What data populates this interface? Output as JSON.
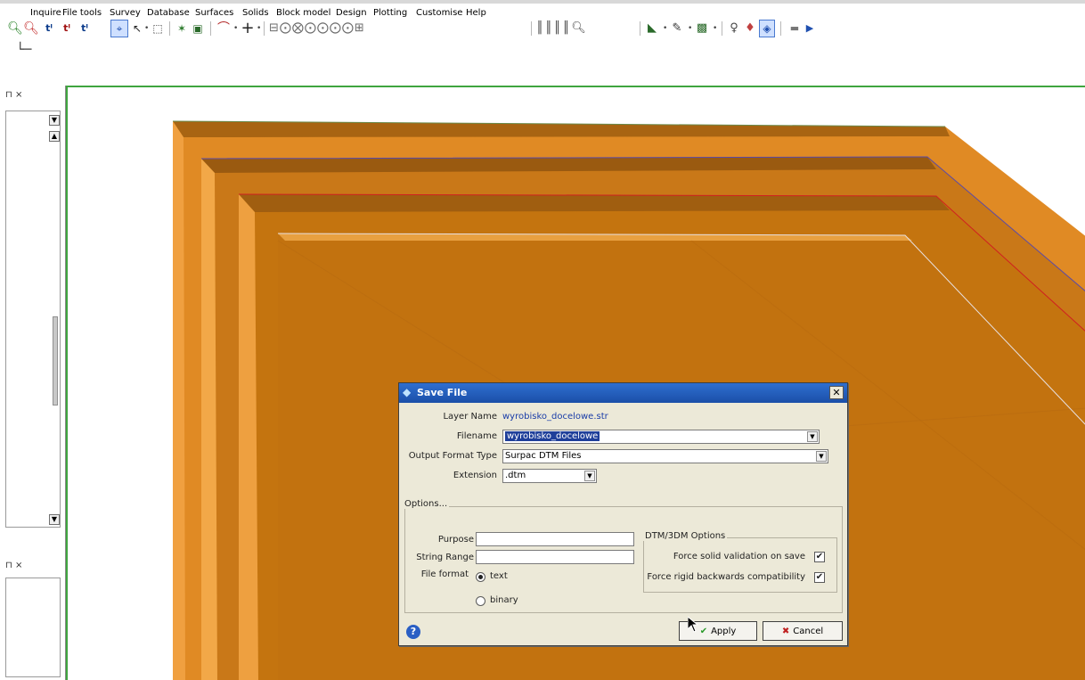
{
  "menu": {
    "items": [
      "Inquire",
      "File tools",
      "Survey",
      "Database",
      "Surfaces",
      "Solids",
      "Block model",
      "Design",
      "Plotting",
      "Customise",
      "Help"
    ]
  },
  "toolbar": {
    "icons": [
      "zoom-icon",
      "zoom-window-icon",
      "axis-zx-icon",
      "axis-zx-alt-icon",
      "axis-zy-icon",
      "view-select-icon",
      "pointer-icon",
      "box-select-icon",
      "layers-icon",
      "image-icon",
      "digitise-icon",
      "crosshair-icon",
      "string-tools-icon",
      "plot-icon",
      "block-icon",
      "shade-icon",
      "map-icon"
    ]
  },
  "left_panel": {
    "pin_close_top": "⊓ ⨯",
    "pin_close_bottom": "⊓ ⨯"
  },
  "dialog": {
    "title": "Save File",
    "layer_name_label": "Layer Name",
    "layer_name_value": "wyrobisko_docelowe.str",
    "filename_label": "Filename",
    "filename_value": "wyrobisko_docelowe",
    "output_format_label": "Output Format Type",
    "output_format_value": "Surpac DTM Files",
    "extension_label": "Extension",
    "extension_value": ".dtm",
    "options_label": "Options...",
    "purpose_label": "Purpose",
    "purpose_value": "",
    "string_range_label": "String Range",
    "string_range_value": "",
    "file_format_label": "File format",
    "file_format_options": [
      "text",
      "binary"
    ],
    "file_format_selected": "text",
    "dtm_group_label": "DTM/3DM Options",
    "force_solid_label": "Force solid validation on save",
    "force_solid_checked": true,
    "force_rigid_label": "Force rigid backwards compatibility",
    "force_rigid_checked": true,
    "apply_label": "Apply",
    "cancel_label": "Cancel"
  },
  "colors": {
    "solid_fill": "#c0700f",
    "solid_light": "#e8902a",
    "solid_dark": "#9a5a10",
    "viewport_border": "#3fa53f",
    "title_bar": "#1b4fa8"
  }
}
